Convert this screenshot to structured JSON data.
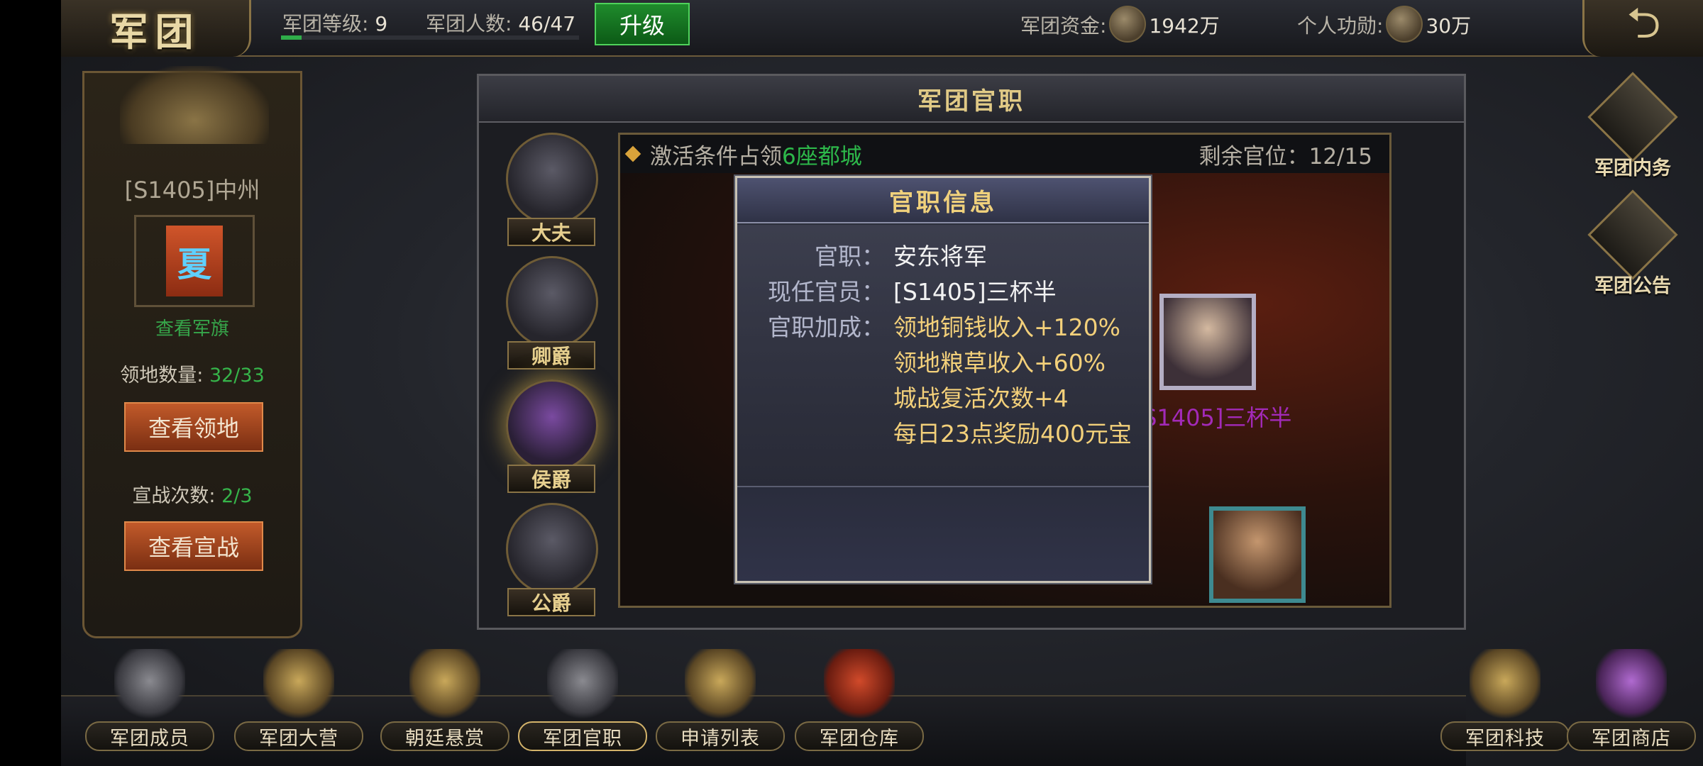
{
  "header": {
    "title": "军团",
    "legion_level_label": "军团等级:",
    "legion_level_value": "9",
    "legion_members_label": "军团人数:",
    "legion_members_value": "46/47",
    "level_progress": 0.07,
    "upgrade_label": "升级",
    "funds_label": "军团资金:",
    "funds_value": "1942万",
    "merit_label": "个人功勋:",
    "merit_value": "30万",
    "back_icon": "back-arrow-icon"
  },
  "left_panel": {
    "server_name": "[S1405]中州",
    "banner_char": "夏",
    "view_banner_link": "查看军旗",
    "territory_label": "领地数量:",
    "territory_value": "32/33",
    "view_territory_button": "查看领地",
    "war_label": "宣战次数:",
    "war_value": "2/3",
    "view_war_button": "查看宣战"
  },
  "main_window": {
    "title": "军团官职",
    "ranks": [
      {
        "label": "大夫",
        "hat": "black-hat-icon",
        "active": false
      },
      {
        "label": "卿爵",
        "hat": "gold-hat-icon",
        "active": false
      },
      {
        "label": "侯爵",
        "hat": "purple-hat-icon",
        "active": true
      },
      {
        "label": "公爵",
        "hat": "crown-icon",
        "active": false
      }
    ],
    "condition_prefix": "激活条件占领",
    "condition_highlight": "6座都城",
    "remaining_label": "剩余官位：",
    "remaining_value": "12/15",
    "holder_name": "[S1405]三杯半"
  },
  "popup": {
    "title": "官职信息",
    "position_label": "官职：",
    "position_value": "安东将军",
    "holder_label": "现任官员：",
    "holder_value": "[S1405]三杯半",
    "bonus_label": "官职加成：",
    "bonuses": [
      "领地铜钱收入+120%",
      "领地粮草收入+60%",
      "城战复活次数+4",
      "每日23点奖励400元宝"
    ]
  },
  "bottom_nav": [
    {
      "label": "军团成员",
      "icon": "members-icon"
    },
    {
      "label": "军团大营",
      "icon": "camp-icon"
    },
    {
      "label": "朝廷悬赏",
      "icon": "bounty-icon"
    },
    {
      "label": "军团官职",
      "icon": "scroll-icon",
      "selected": true
    },
    {
      "label": "申请列表",
      "icon": "application-icon"
    },
    {
      "label": "军团仓库",
      "icon": "chest-icon"
    },
    {
      "label": "军团科技",
      "icon": "tech-icon"
    },
    {
      "label": "军团商店",
      "icon": "shop-icon"
    }
  ],
  "side_buttons": [
    {
      "label": "军团内务",
      "icon": "affairs-icon"
    },
    {
      "label": "军团公告",
      "icon": "notice-icon"
    }
  ],
  "colors": {
    "gold": "#f3d07a",
    "green": "#2db84a",
    "purple_name": "#a22ab8",
    "orange_button": "#c25a2a"
  }
}
